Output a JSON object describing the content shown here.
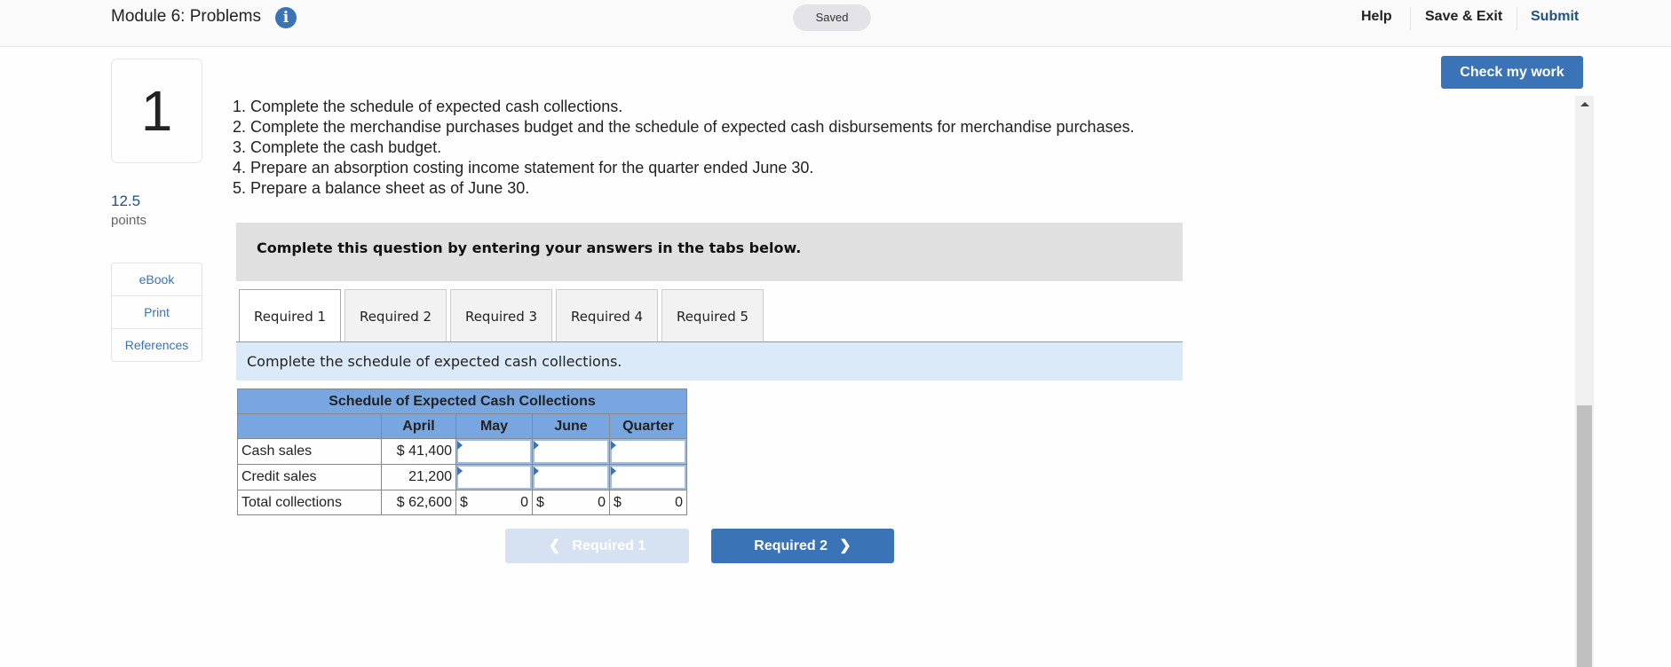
{
  "header": {
    "module_title": "Module 6: Problems",
    "info_icon": "info-icon",
    "saved_status": "Saved",
    "nav": {
      "help": "Help",
      "save_exit": "Save & Exit",
      "submit": "Submit"
    },
    "check_my_work": "Check my work"
  },
  "question": {
    "number": "1",
    "points_value": "12.5",
    "points_label": "points",
    "side_links": [
      "eBook",
      "Print",
      "References"
    ],
    "instructions": [
      "1. Complete the schedule of expected cash collections.",
      "2. Complete the merchandise purchases budget and the schedule of expected cash disbursements for merchandise purchases.",
      "3. Complete the cash budget.",
      "4. Prepare an absorption costing income statement for the quarter ended June 30.",
      "5. Prepare a balance sheet as of June 30."
    ],
    "banner": "Complete this question by entering your answers in the tabs below.",
    "tabs": [
      "Required 1",
      "Required 2",
      "Required 3",
      "Required 4",
      "Required 5"
    ],
    "active_tab": "Required 1",
    "prompt": "Complete the schedule of expected cash collections."
  },
  "schedule": {
    "title": "Schedule of Expected Cash Collections",
    "columns": [
      "April",
      "May",
      "June",
      "Quarter"
    ],
    "rows": [
      {
        "label": "Cash sales",
        "april": "$ 41,400",
        "may": "",
        "june": "",
        "quarter": ""
      },
      {
        "label": "Credit sales",
        "april": "21,200",
        "may": "",
        "june": "",
        "quarter": ""
      }
    ],
    "total": {
      "label": "Total collections",
      "april": "$ 62,600",
      "currency": "$",
      "may": "0",
      "june": "0",
      "quarter": "0"
    }
  },
  "pager": {
    "prev_label": "Required 1",
    "next_label": "Required 2",
    "prev_icon": "chevron-left-icon",
    "next_icon": "chevron-right-icon"
  },
  "scrollbar": {
    "position_fraction": 1.0
  }
}
